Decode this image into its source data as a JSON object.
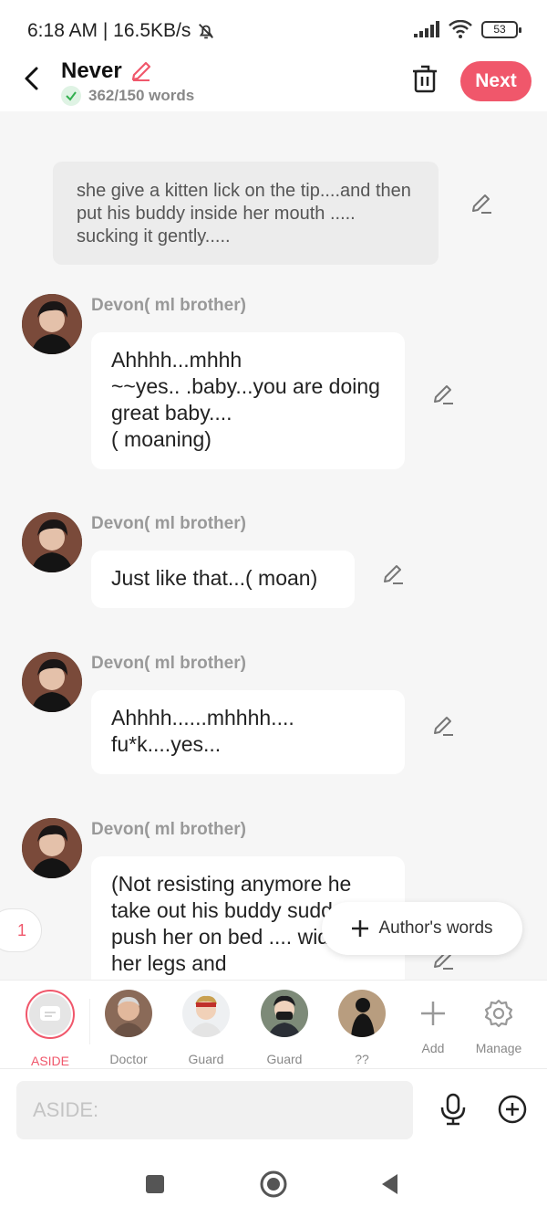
{
  "status": {
    "time_speed": "6:18 AM | 16.5KB/s",
    "battery": "53"
  },
  "header": {
    "title": "Never",
    "word_count": "362/150 words",
    "next_label": "Next"
  },
  "chat": {
    "aside_text": "she give a kitten lick on the tip....and then put his buddy inside her mouth ..... sucking it gently.....",
    "messages": [
      {
        "speaker": "Devon( ml brother)",
        "text": "Ahhhh...mhhh\n~~yes.. .baby...you are doing great baby....\n( moaning)"
      },
      {
        "speaker": "Devon( ml brother)",
        "text": "Just like that...( moan)"
      },
      {
        "speaker": "Devon( ml brother)",
        "text": "Ahhhh......mhhhh....\nfu*k....yes..."
      },
      {
        "speaker": "Devon( ml brother)",
        "text": "(Not resisting anymore he take out his buddy suddenly push her on bed .... widen her legs and"
      }
    ],
    "side_counter": "1",
    "authors_words": "Author's words"
  },
  "characters": [
    {
      "label": "ASIDE"
    },
    {
      "label": "Doctor"
    },
    {
      "label": "Guard"
    },
    {
      "label": "Guard"
    },
    {
      "label": "??"
    },
    {
      "label": "Add"
    },
    {
      "label": "Manage"
    }
  ],
  "input": {
    "placeholder": "ASIDE:"
  },
  "colors": {
    "accent": "#f0576b",
    "bubble": "#ffffff",
    "aside_bubble": "#ececec"
  }
}
